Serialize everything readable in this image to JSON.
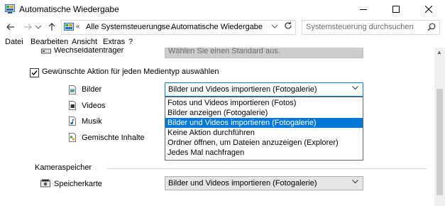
{
  "window": {
    "title": "Automatische Wiedergabe"
  },
  "address": {
    "prefix": "«",
    "path1": "Alle Systemsteuerungse...",
    "separator": "›",
    "path2": "Automatische Wiedergabe"
  },
  "search": {
    "placeholder": "Systemsteuerung durchsuchen"
  },
  "menu": {
    "items": [
      "Datei",
      "Bearbeiten",
      "Ansicht",
      "Extras",
      "?"
    ]
  },
  "removable": {
    "label": "Wechseldatenträger",
    "value": "Wählen Sie einen Standard aus."
  },
  "per_media": {
    "checkbox_label": "Gewünschte Aktion für jeden Medientyp auswählen",
    "checked": true
  },
  "media": [
    {
      "label": "Bilder",
      "value": "Bilder und Videos importieren (Fotogalerie)"
    },
    {
      "label": "Videos"
    },
    {
      "label": "Musik"
    },
    {
      "label": "Gemischte Inhalte"
    }
  ],
  "dropdown": {
    "options": [
      "Fotos und Videos importieren (Fotos)",
      "Bilder anzeigen (Fotogalerie)",
      "Bilder und Videos importieren (Fotogalerie)",
      "Keine Aktion durchführen",
      "Ordner öffnen, um Dateien anzuzeigen (Explorer)",
      "Jedes Mal nachfragen"
    ],
    "selected_index": 2
  },
  "camera": {
    "section_title": "Kameraspeicher",
    "label": "Speicherkarte",
    "value": "Bilder und Videos importieren (Fotogalerie)"
  },
  "colors": {
    "accent": "#0078d7",
    "disabled_combo": "#cccccc",
    "combo_bg": "#e5e5e5"
  }
}
